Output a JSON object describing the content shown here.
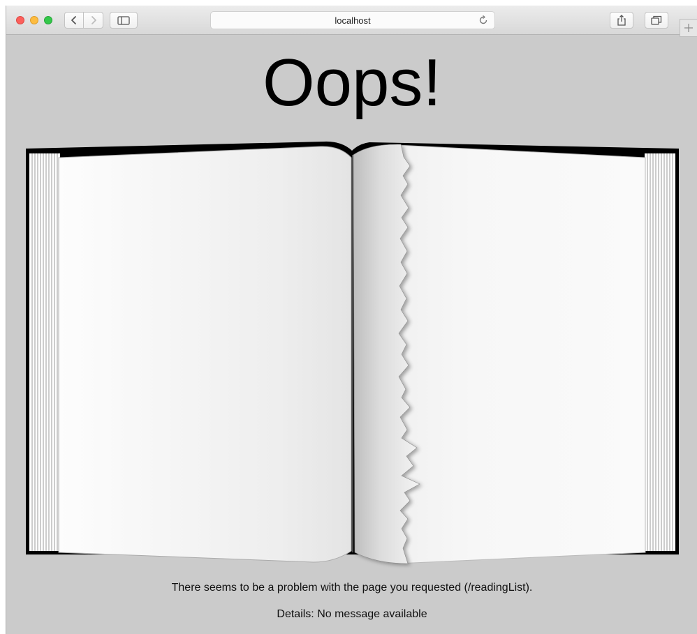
{
  "browser": {
    "address_url": "localhost",
    "icons": {
      "back": "chevron-left-icon",
      "forward": "chevron-right-icon",
      "sidebar": "sidebar-icon",
      "reload": "reload-icon",
      "share": "share-icon",
      "tabs": "tabs-icon",
      "new_tab": "plus-icon"
    }
  },
  "page": {
    "headline": "Oops!",
    "illustration": "torn-book",
    "message": "There seems to be a problem with the page you requested (/readingList).",
    "details": "Details: No message available"
  }
}
